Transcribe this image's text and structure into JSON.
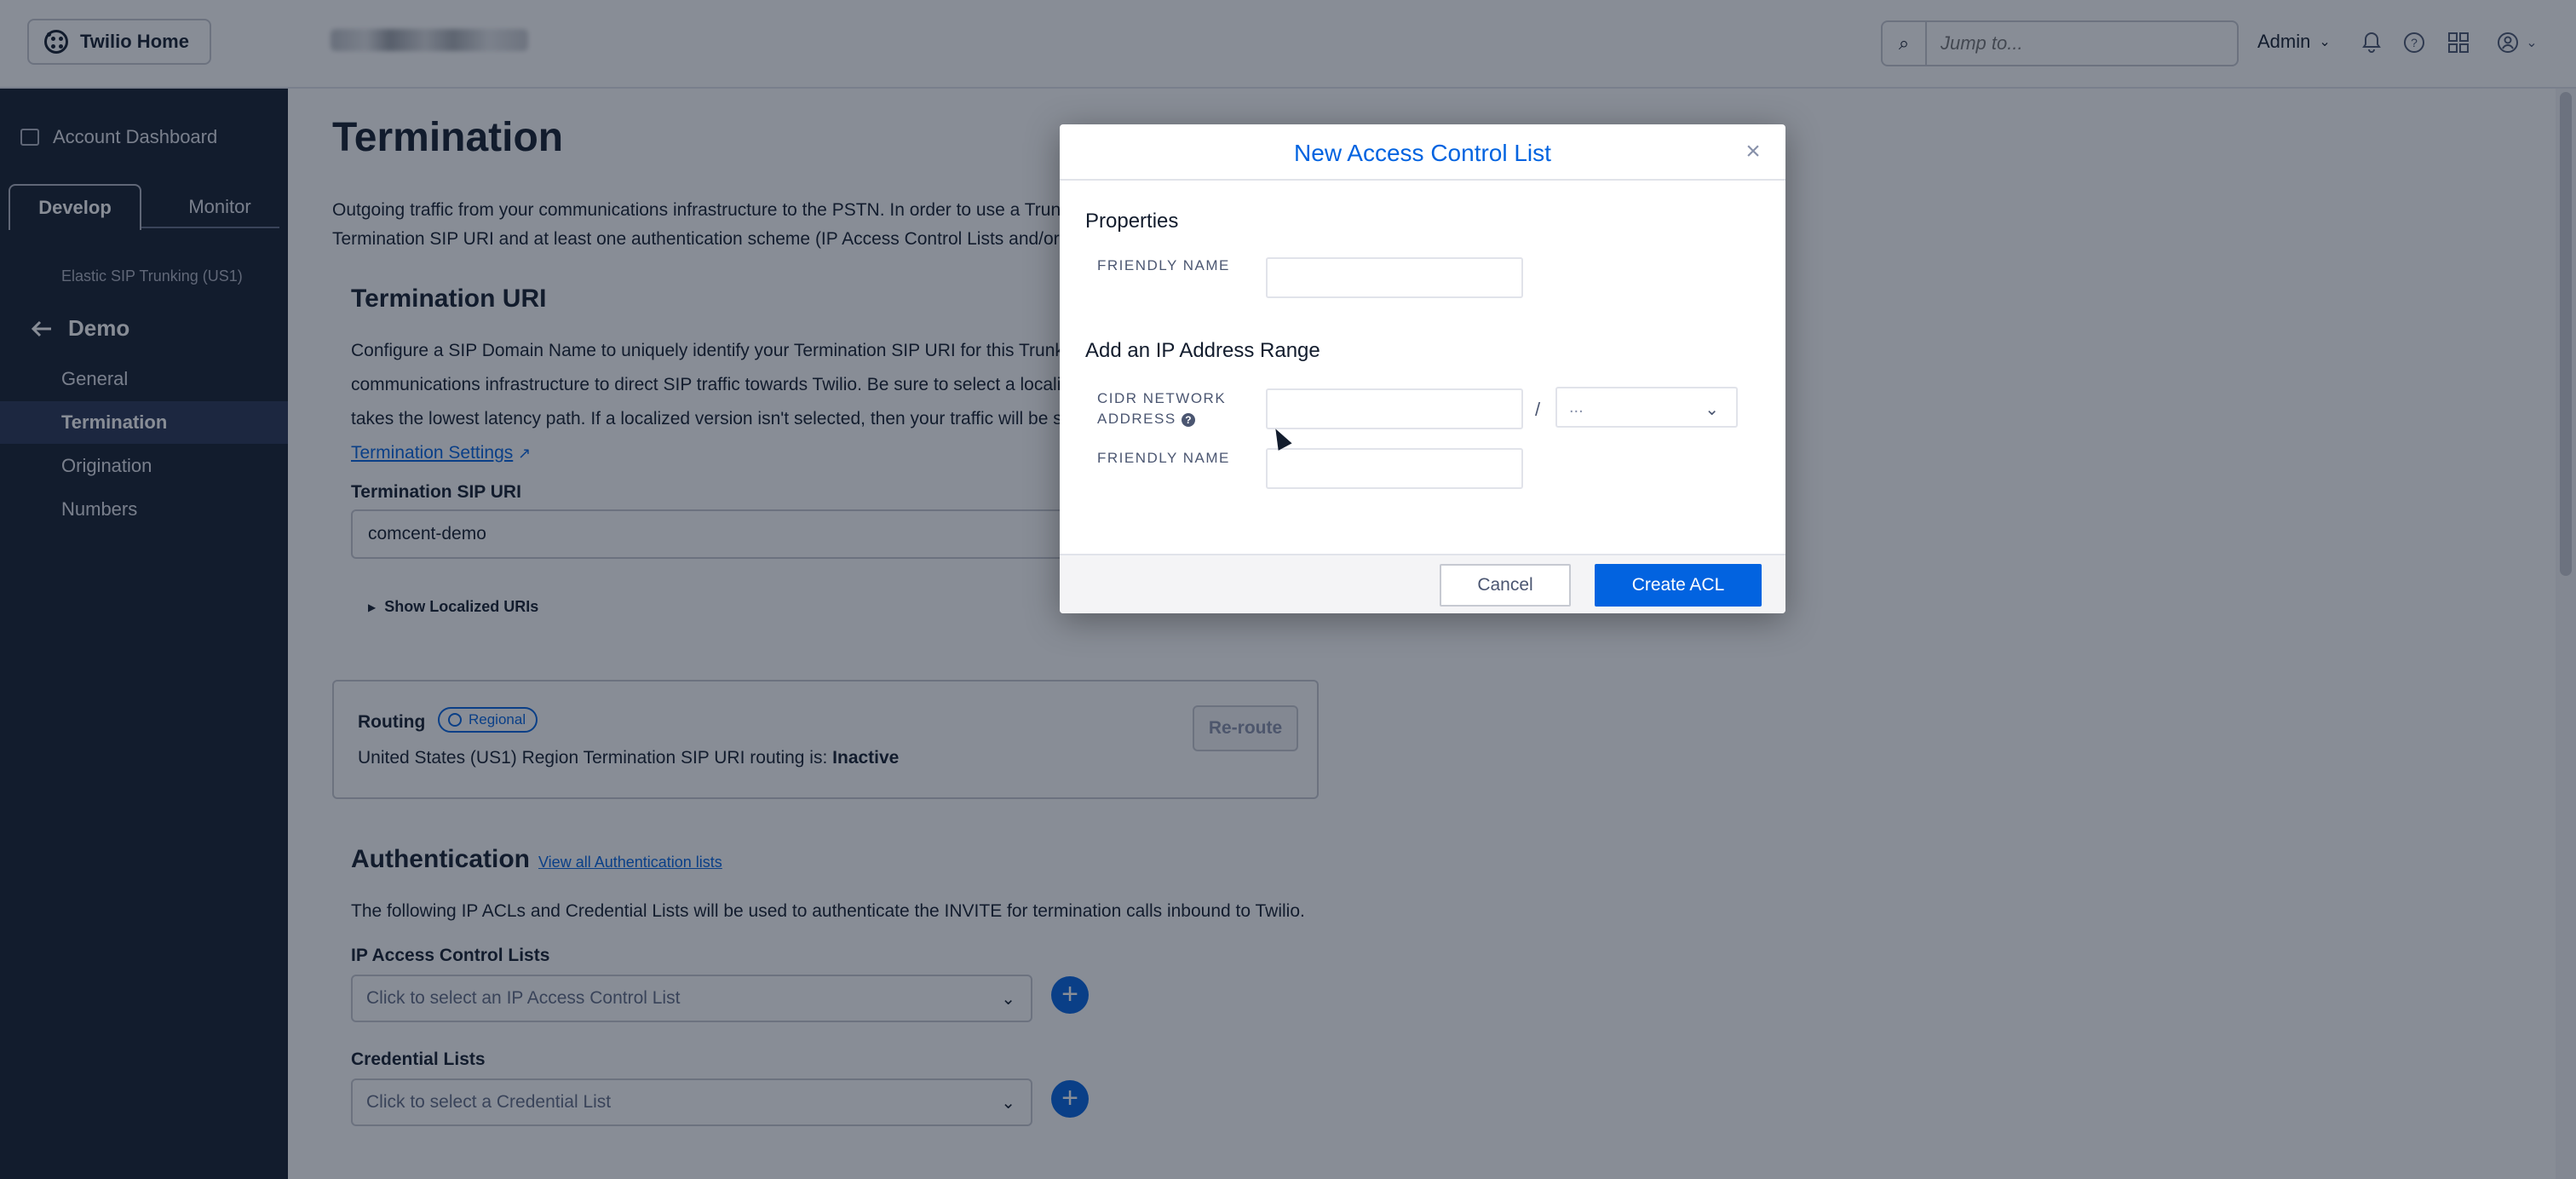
{
  "topbar": {
    "home_label": "Twilio Home",
    "search_placeholder": "Jump to...",
    "admin_label": "Admin",
    "icons": [
      "search-icon",
      "bell-icon",
      "help-icon",
      "apps-grid-icon",
      "user-icon"
    ]
  },
  "sidebar": {
    "dashboard_label": "Account Dashboard",
    "tabs": [
      {
        "label": "Develop",
        "active": true
      },
      {
        "label": "Monitor",
        "active": false
      }
    ],
    "product_label": "Elastic SIP Trunking (US1)",
    "back_label": "Demo",
    "items": [
      {
        "label": "General",
        "active": false
      },
      {
        "label": "Termination",
        "active": true
      },
      {
        "label": "Origination",
        "active": false
      },
      {
        "label": "Numbers",
        "active": false
      }
    ]
  },
  "main": {
    "title": "Termination",
    "intro_line1": "Outgoing traffic from your communications infrastructure to the PSTN. In order to use a Trunk",
    "intro_line2": "Termination SIP URI and at least one authentication scheme (IP Access Control Lists and/or C",
    "termination_uri": {
      "title": "Termination URI",
      "line1": "Configure a SIP Domain Name to uniquely identify your Termination SIP URI for this Trunk. T",
      "line2": "communications infrastructure to direct SIP traffic towards Twilio. Be sure to select a localiz",
      "line3": "takes the lowest latency path. If a localized version isn't selected, then your traffic will be s",
      "settings_link": "Termination Settings",
      "field_label": "Termination SIP URI",
      "field_value": "comcent-demo",
      "show_localized": "Show Localized URIs"
    },
    "routing": {
      "title": "Routing",
      "badge": "Regional",
      "status_prefix": "United States (US1) Region Termination SIP URI routing is: ",
      "status_value": "Inactive",
      "reroute_label": "Re-route"
    },
    "authentication": {
      "title": "Authentication",
      "view_all_link": "View all Authentication lists",
      "description": "The following IP ACLs and Credential Lists will be used to authenticate the INVITE for termination calls inbound to Twilio.",
      "ip_acl_label": "IP Access Control Lists",
      "ip_acl_placeholder": "Click to select an IP Access Control List",
      "cred_label": "Credential Lists",
      "cred_placeholder": "Click to select a Credential List"
    }
  },
  "modal": {
    "title": "New Access Control List",
    "properties_title": "Properties",
    "friendly_name_label": "FRIENDLY NAME",
    "friendly_name_value": "",
    "ip_range_title": "Add an IP Address Range",
    "cidr_label_line1": "CIDR NETWORK",
    "cidr_label_line2": "ADDRESS",
    "cidr_value": "",
    "cidr_slash": "/",
    "cidr_prefix_placeholder": "...",
    "range_friendly_name_label": "FRIENDLY NAME",
    "range_friendly_name_value": "",
    "cancel_label": "Cancel",
    "create_label": "Create ACL"
  },
  "colors": {
    "sidebar_bg": "#121c2d",
    "accent_blue": "#0263e0",
    "overlay": "rgba(18,28,45,0.5)"
  }
}
